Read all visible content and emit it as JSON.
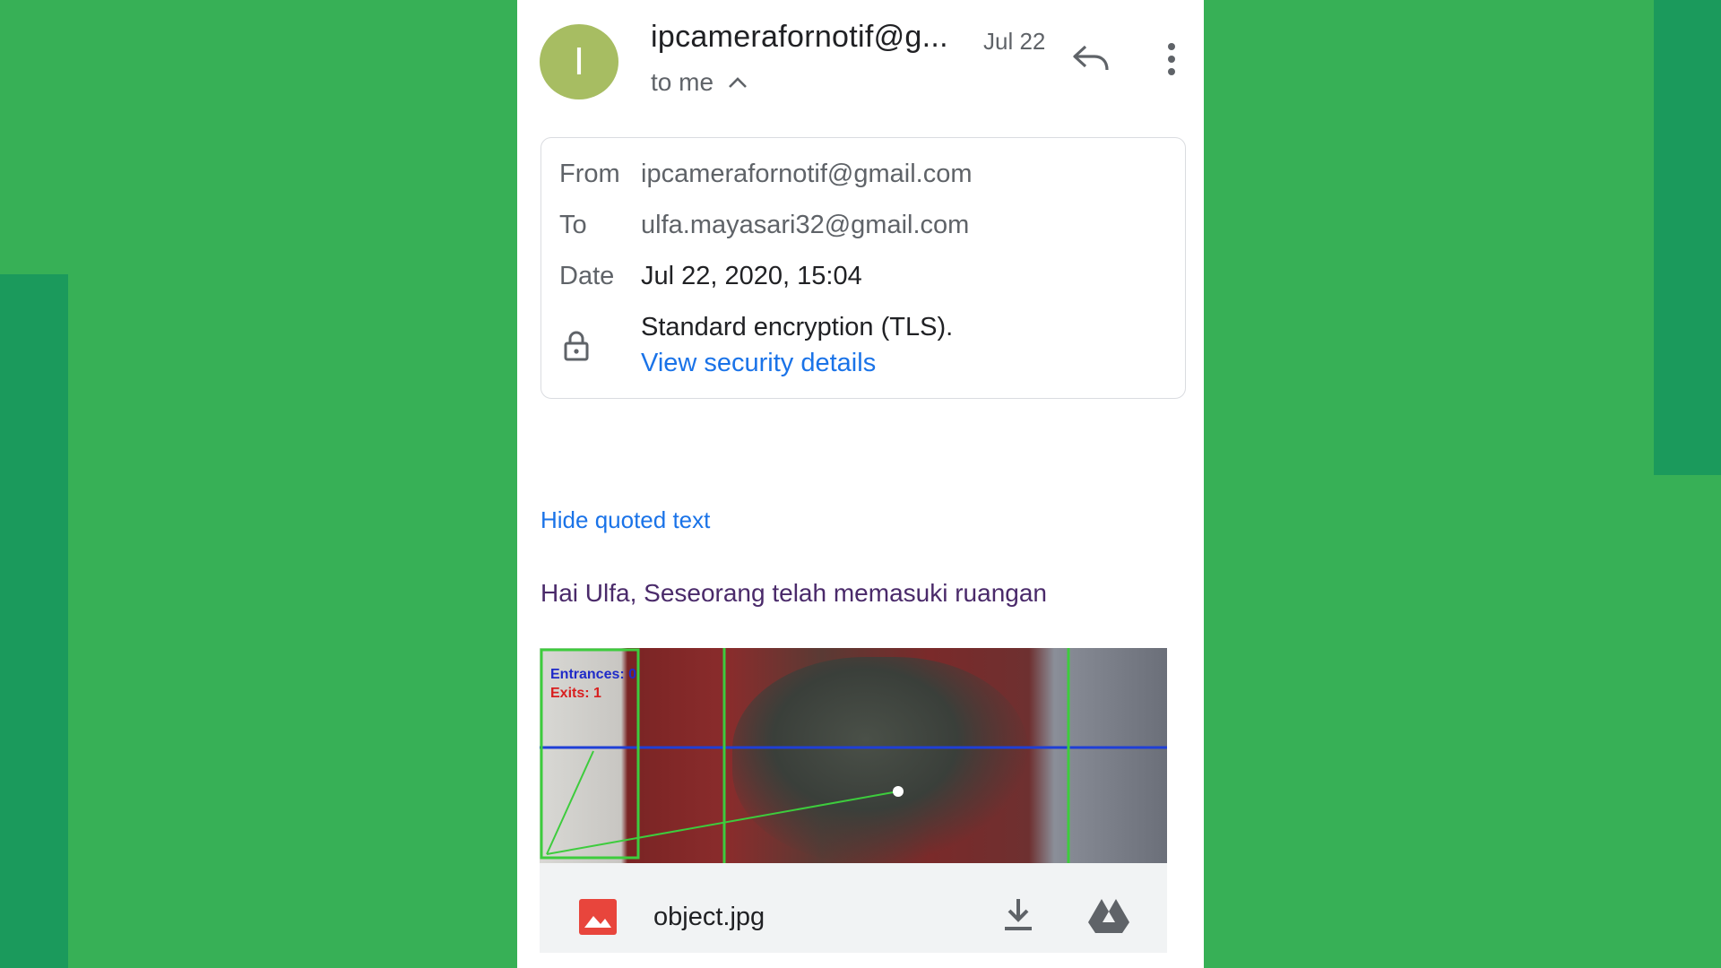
{
  "header": {
    "avatar_letter": "I",
    "sender": "ipcamerafornotif@g...",
    "date": "Jul 22",
    "recipient": "to me"
  },
  "details": {
    "from_label": "From",
    "from_value": "ipcamerafornotif@gmail.com",
    "to_label": "To",
    "to_value": "ulfa.mayasari32@gmail.com",
    "date_label": "Date",
    "date_value": "Jul 22, 2020, 15:04",
    "encryption": "Standard encryption (TLS).",
    "security_link": "View security details"
  },
  "body": {
    "hide_quoted": "Hide quoted text",
    "message": "Hai Ulfa, Seseorang telah memasuki ruangan"
  },
  "attachment": {
    "image_entrances_text": "Entrances: 0",
    "image_exits_text": "Exits: 1",
    "filename": "object.jpg"
  },
  "colors": {
    "background": "#37b056",
    "accent_dark_green": "#1b9a5c",
    "link_blue": "#1a73e8",
    "avatar": "#a7bd62",
    "attachment_icon_red": "#e8453c"
  },
  "icons": {
    "reply": "reply-icon",
    "more": "more-vert-icon",
    "chevron": "chevron-up-icon",
    "lock": "lock-icon",
    "image": "image-icon",
    "download": "download-icon",
    "drive": "drive-icon"
  }
}
